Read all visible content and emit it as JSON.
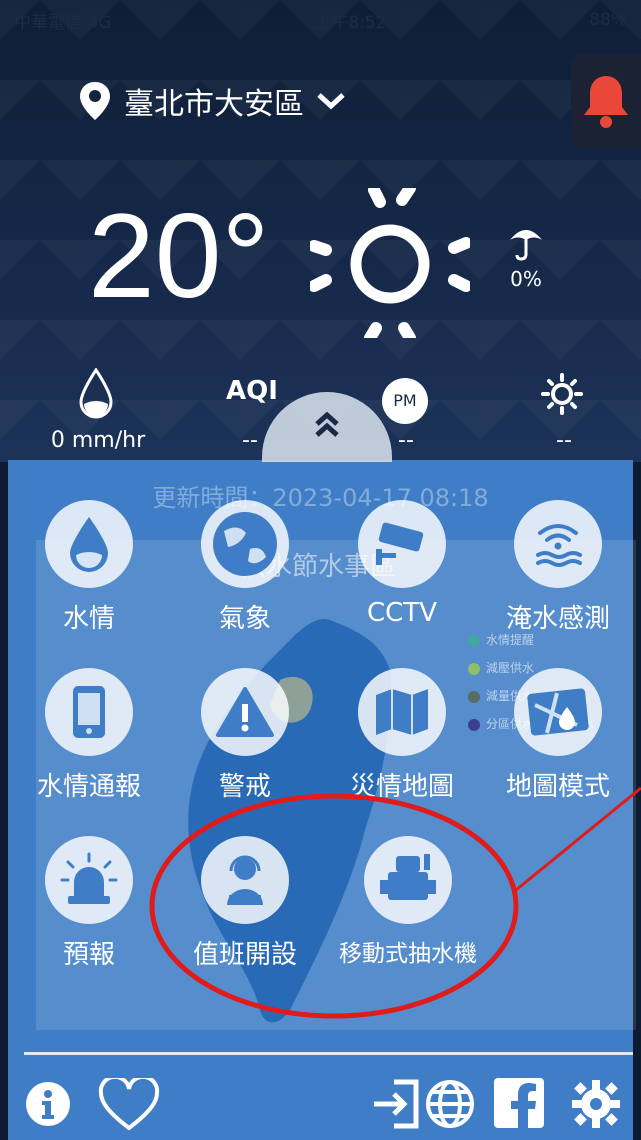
{
  "status_bar": {
    "carrier": "中華電信 4G",
    "time": "上午8:52",
    "battery": "88%"
  },
  "location": {
    "name": "臺北市大安區"
  },
  "weather": {
    "temperature": "20°",
    "rain_probability": "0%",
    "rainfall": "0 mm/hr",
    "aqi_label": "AQI",
    "aqi_value": "--",
    "pm_label": "PM",
    "pm_value": "--",
    "uv_value": "--"
  },
  "panel": {
    "update_time": "更新時間：2023-04-17 08:18",
    "map_title": "供水節水事區",
    "legend": [
      "水情提醒",
      "減壓供水",
      "減量供水",
      "分區供水或定點供水"
    ],
    "legend_colors": [
      "#3fa7a0",
      "#8fbf6a",
      "#5a6b63",
      "#3c3f8f"
    ],
    "tiles": [
      {
        "label": "水情",
        "icon": "water-drop-icon"
      },
      {
        "label": "氣象",
        "icon": "globe-icon"
      },
      {
        "label": "CCTV",
        "icon": "cctv-camera-icon"
      },
      {
        "label": "淹水感測",
        "icon": "wifi-water-icon"
      },
      {
        "label": "水情通報",
        "icon": "phone-report-icon"
      },
      {
        "label": "警戒",
        "icon": "warning-icon"
      },
      {
        "label": "災情地圖",
        "icon": "folded-map-icon"
      },
      {
        "label": "地圖模式",
        "icon": "map-pin-icon"
      },
      {
        "label": "預報",
        "icon": "siren-icon"
      },
      {
        "label": "值班開設",
        "icon": "duty-operator-icon"
      },
      {
        "label": "移動式抽水機",
        "icon": "pump-icon"
      }
    ]
  },
  "colors": {
    "panel": "#3f7ec7",
    "bell": "#e8473a",
    "highlight": "#e01b1b"
  }
}
